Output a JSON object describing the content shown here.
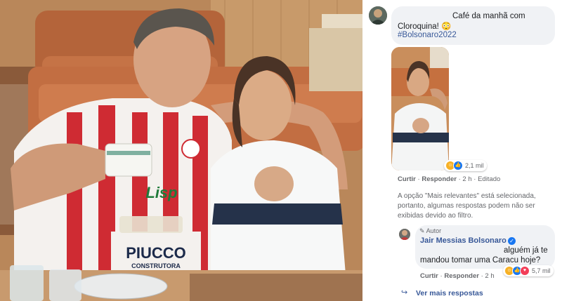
{
  "post_photo": {
    "alt": "photo"
  },
  "comment": {
    "text_line1": "Café da manhã com",
    "text_line2": "Cloroquina! 😳",
    "hashtag": "#Bolsonaro2022",
    "actions": {
      "like": "Curtir",
      "reply": "Responder",
      "time": "2 h",
      "edited": "Editado"
    },
    "reactions_count": "2,1 mil"
  },
  "filter_notice": "A opção \"Mais relevantes\" está selecionada, portanto, algumas respostas podem não ser exibidas devido ao filtro.",
  "reply": {
    "badge": "Autor",
    "author": "Jair Messias Bolsonaro",
    "text_line1": "alguém já te",
    "text_line2": "mandou tomar uma Caracu hoje?",
    "actions": {
      "like": "Curtir",
      "reply": "Responder",
      "time": "2 h"
    },
    "reactions_count": "5,7 mil"
  },
  "more_replies": "Ver mais respostas",
  "jersey_text": {
    "line1": "PIUCCO",
    "line2": "CONSTRUTORA",
    "sponsor": "Lisp"
  },
  "colors": {
    "link": "#385898",
    "bubble": "#f0f2f5",
    "meta": "#65676b",
    "verified": "#1877f2"
  }
}
